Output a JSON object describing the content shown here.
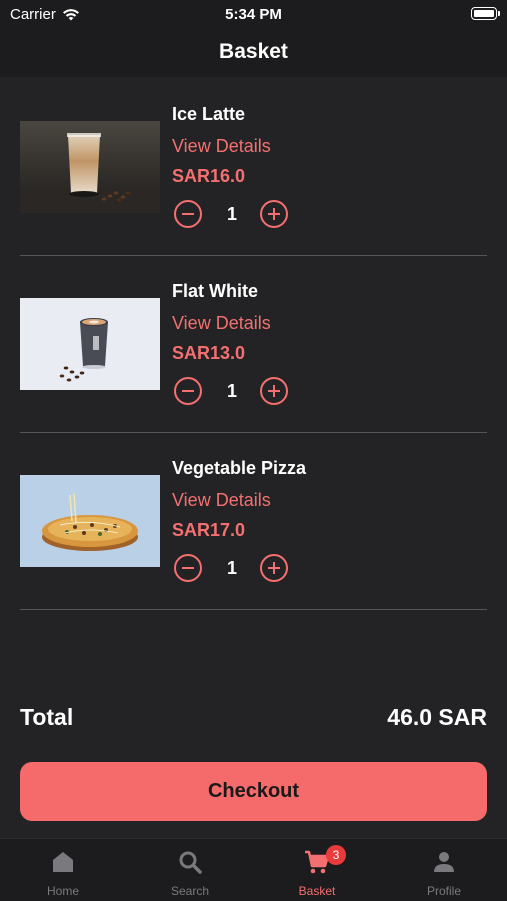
{
  "status_bar": {
    "carrier": "Carrier",
    "time": "5:34 PM"
  },
  "navbar": {
    "title": "Basket"
  },
  "items": [
    {
      "name": "Ice Latte",
      "details_label": "View Details",
      "price": "SAR16.0",
      "quantity": "1"
    },
    {
      "name": "Flat White",
      "details_label": "View Details",
      "price": "SAR13.0",
      "quantity": "1"
    },
    {
      "name": "Vegetable Pizza",
      "details_label": "View Details",
      "price": "SAR17.0",
      "quantity": "1"
    }
  ],
  "summary": {
    "total_label": "Total",
    "total_value": "46.0 SAR"
  },
  "checkout": {
    "label": "Checkout"
  },
  "tabbar": {
    "tabs": [
      {
        "label": "Home",
        "icon": "home-icon"
      },
      {
        "label": "Search",
        "icon": "search-icon"
      },
      {
        "label": "Basket",
        "icon": "cart-icon",
        "badge": "3"
      },
      {
        "label": "Profile",
        "icon": "profile-icon"
      }
    ],
    "active_tab": "Basket"
  },
  "colors": {
    "accent": "#f47070",
    "background": "#232325",
    "bar": "#1c1c1e",
    "badge": "#e83b3b"
  }
}
